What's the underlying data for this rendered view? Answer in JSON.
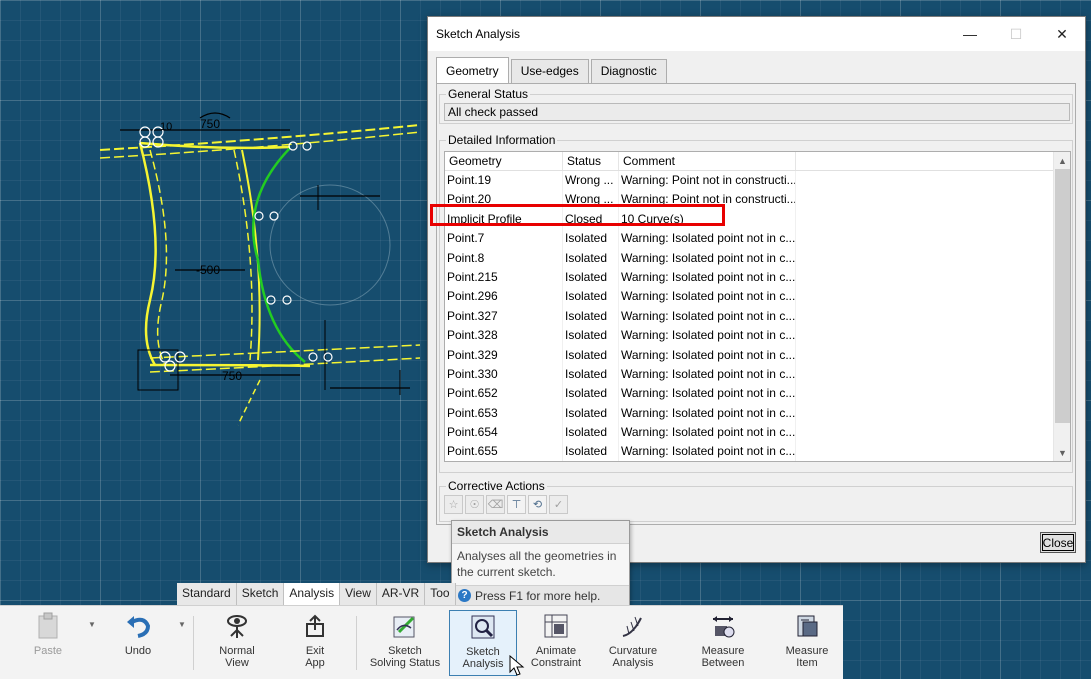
{
  "dialog": {
    "title": "Sketch Analysis",
    "tabs": [
      "Geometry",
      "Use-edges",
      "Diagnostic"
    ],
    "active_tab": "Geometry",
    "general_status_label": "General Status",
    "general_status_value": "All check passed",
    "detailed_info_label": "Detailed Information",
    "columns": [
      "Geometry",
      "Status",
      "Comment"
    ],
    "rows": [
      {
        "geometry": "Point.19",
        "status": "Wrong ...",
        "comment": "Warning: Point not in constructi..."
      },
      {
        "geometry": "Point.20",
        "status": "Wrong ...",
        "comment": "Warning: Point not in constructi..."
      },
      {
        "geometry": "Implicit Profile",
        "status": "Closed",
        "comment": "10 Curve(s)"
      },
      {
        "geometry": "Point.7",
        "status": "Isolated",
        "comment": "Warning: Isolated point not in c..."
      },
      {
        "geometry": "Point.8",
        "status": "Isolated",
        "comment": "Warning: Isolated point not in c..."
      },
      {
        "geometry": "Point.215",
        "status": "Isolated",
        "comment": "Warning: Isolated point not in c..."
      },
      {
        "geometry": "Point.296",
        "status": "Isolated",
        "comment": "Warning: Isolated point not in c..."
      },
      {
        "geometry": "Point.327",
        "status": "Isolated",
        "comment": "Warning: Isolated point not in c..."
      },
      {
        "geometry": "Point.328",
        "status": "Isolated",
        "comment": "Warning: Isolated point not in c..."
      },
      {
        "geometry": "Point.329",
        "status": "Isolated",
        "comment": "Warning: Isolated point not in c..."
      },
      {
        "geometry": "Point.330",
        "status": "Isolated",
        "comment": "Warning: Isolated point not in c..."
      },
      {
        "geometry": "Point.652",
        "status": "Isolated",
        "comment": "Warning: Isolated point not in c..."
      },
      {
        "geometry": "Point.653",
        "status": "Isolated",
        "comment": "Warning: Isolated point not in c..."
      },
      {
        "geometry": "Point.654",
        "status": "Isolated",
        "comment": "Warning: Isolated point not in c..."
      },
      {
        "geometry": "Point.655",
        "status": "Isolated",
        "comment": "Warning: Isolated point not in c..."
      }
    ],
    "corrective_actions_label": "Corrective Actions",
    "close_label": "Close",
    "highlight_color": "#e80000"
  },
  "tooltip": {
    "title": "Sketch Analysis",
    "body": "Analyses all the geometries in the current sketch.",
    "help": "Press F1 for more help."
  },
  "ribbon": {
    "tabs": [
      "Standard",
      "Sketch",
      "Analysis",
      "View",
      "AR-VR",
      "Too"
    ],
    "active_tab": "Analysis",
    "buttons": [
      {
        "label1": "Paste",
        "label2": "",
        "icon": "paste-icon"
      },
      {
        "label1": "Undo",
        "label2": "",
        "icon": "undo-icon"
      },
      {
        "label1": "Normal",
        "label2": "View",
        "icon": "normal-view-icon"
      },
      {
        "label1": "Exit",
        "label2": "App",
        "icon": "exit-app-icon"
      },
      {
        "label1": "Sketch",
        "label2": "Solving Status",
        "icon": "sketch-solving-status-icon"
      },
      {
        "label1": "Sketch",
        "label2": "Analysis",
        "icon": "sketch-analysis-icon"
      },
      {
        "label1": "Animate",
        "label2": "Constraint",
        "icon": "animate-constraint-icon"
      },
      {
        "label1": "Curvature",
        "label2": "Analysis",
        "icon": "curvature-analysis-icon"
      },
      {
        "label1": "Measure",
        "label2": "Between",
        "icon": "measure-between-icon"
      },
      {
        "label1": "Measure",
        "label2": "Item",
        "icon": "measure-item-icon"
      }
    ]
  },
  "sketch": {
    "dim_top": "750",
    "dim_left": "-500",
    "dim_bottom": "750",
    "dim_partial": "10"
  },
  "colors": {
    "viewport": "#164d6e",
    "sketch_yellow": "#f5f532",
    "sketch_green": "#22cc22"
  }
}
